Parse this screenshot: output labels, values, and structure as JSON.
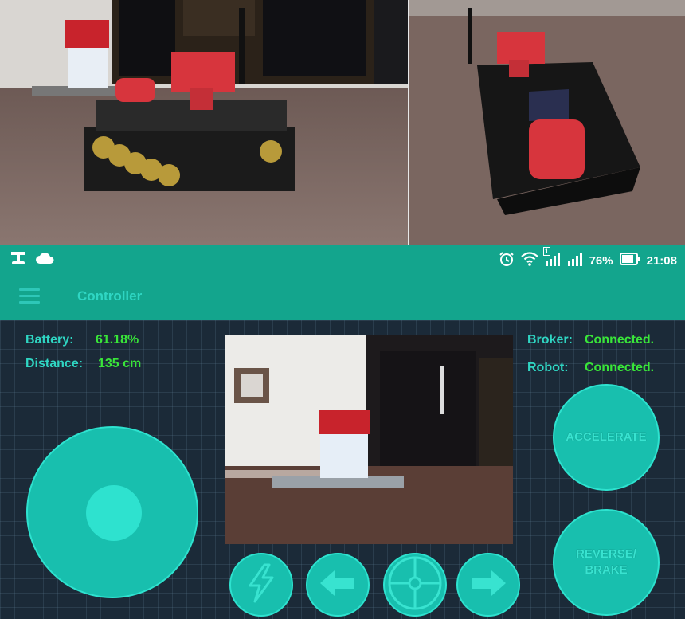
{
  "statusbar": {
    "battery_percent": "76%",
    "time": "21:08",
    "sim1_label": "1"
  },
  "appbar": {
    "title": "Controller"
  },
  "telemetry": {
    "battery_label": "Battery:",
    "battery_value": "61.18%",
    "distance_label": "Distance:",
    "distance_value": "135 cm",
    "broker_label": "Broker:",
    "broker_value": "Connected.",
    "robot_label": "Robot:",
    "robot_value": "Connected."
  },
  "controls": {
    "accelerate_label": "ACCELERATE",
    "reverse_line1": "REVERSE/",
    "reverse_line2": "BRAKE"
  },
  "icons": {
    "notif1": "robot-icon",
    "notif2": "cloud-icon",
    "alarm": "alarm-icon",
    "wifi": "wifi-icon",
    "signal": "signal-icon",
    "battery": "battery-icon",
    "menu": "hamburger-icon",
    "power": "lightning-icon",
    "left": "arrow-left-icon",
    "center": "crosshair-icon",
    "right": "arrow-right-icon"
  },
  "colors": {
    "primary": "#13a58d",
    "accent": "#2fd6c3",
    "value_green": "#39e639",
    "background": "#1b2a38"
  }
}
